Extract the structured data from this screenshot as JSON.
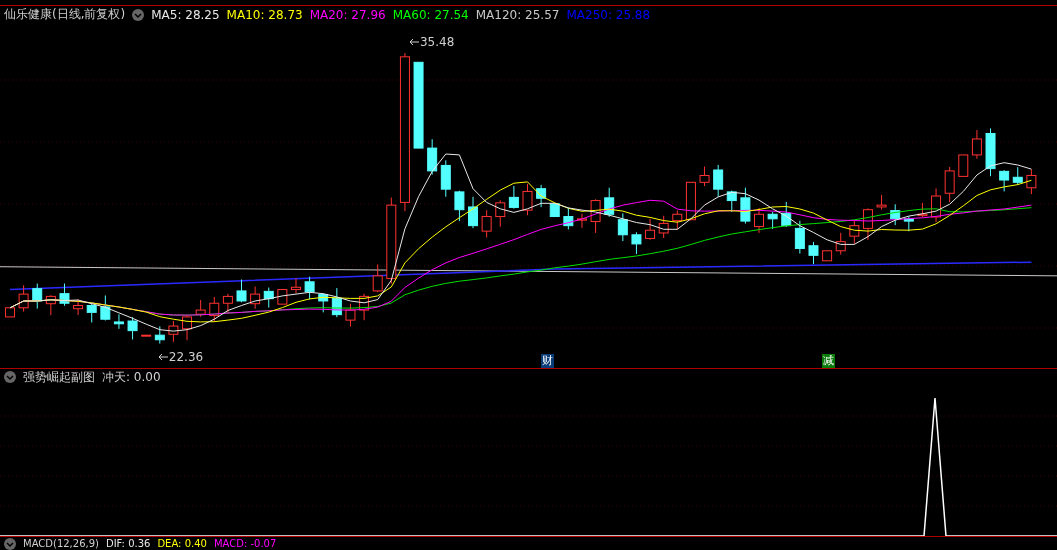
{
  "header": {
    "stock": "仙乐健康(日线,前复权)",
    "indicators": [
      {
        "label": "MA5: 28.25",
        "color": "#e8e8e8"
      },
      {
        "label": "MA10: 28.73",
        "color": "#ffff00"
      },
      {
        "label": "MA20: 27.96",
        "color": "#ff00ff"
      },
      {
        "label": "MA60: 27.54",
        "color": "#00ff00"
      },
      {
        "label": "MA120: 25.57",
        "color": "#c8c8c8"
      },
      {
        "label": "MA250: 25.88",
        "color": "#0000ff"
      }
    ]
  },
  "main_chart": {
    "high_label": "35.48",
    "low_label": "22.36",
    "markers": [
      {
        "label": "财",
        "color": "#0a3c78"
      },
      {
        "label": "减",
        "color": "#0a7a0a"
      }
    ]
  },
  "sub_chart": {
    "title": "强势崛起副图",
    "reading": "冲天: 0.00"
  },
  "macd": {
    "title": "MACD(12,26,9)",
    "items": [
      {
        "label": "DIF: 0.36",
        "color": "#e8e8e8"
      },
      {
        "label": "DEA: 0.40",
        "color": "#ffff00"
      },
      {
        "label": "MACD: -0.07",
        "color": "#ff00ff"
      }
    ]
  }
}
